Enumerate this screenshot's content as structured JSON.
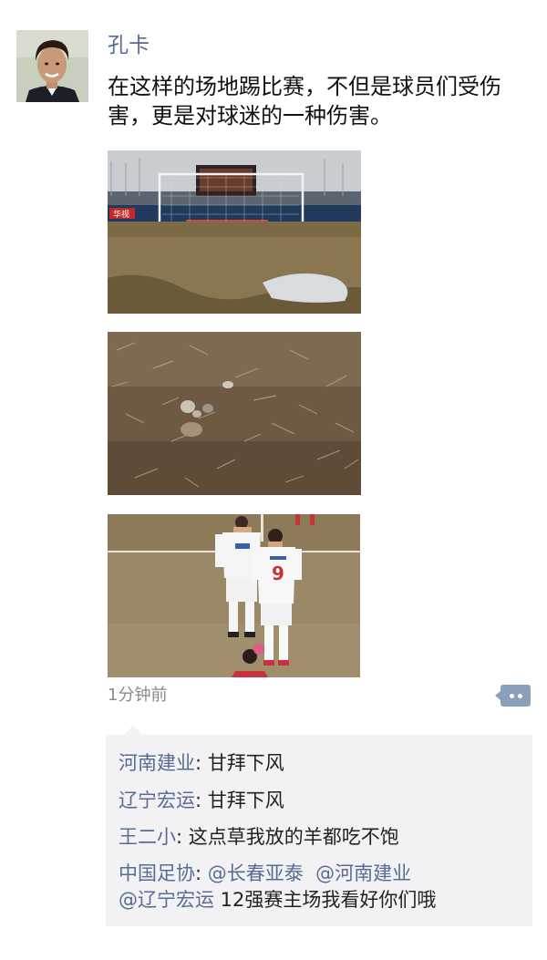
{
  "post": {
    "username": "孔卡",
    "text": "在这样的场地踢比赛，不但是球员们受伤害，更是对球迷的一种伤害。",
    "time": "1分钟前",
    "photos": [
      {
        "icon": "stadium-pitch-photo",
        "banner_text": "华视"
      },
      {
        "icon": "dirt-closeup-photo"
      },
      {
        "icon": "players-on-pitch-photo",
        "shirt_number": "9"
      }
    ]
  },
  "comments": [
    {
      "name": "河南建业",
      "separator": ": ",
      "text": "甘拜下风"
    },
    {
      "name": "辽宁宏运",
      "separator": ": ",
      "text": "甘拜下风"
    },
    {
      "name": "王二小",
      "separator": ": ",
      "text": "这点草我放的羊都吃不饱"
    },
    {
      "name": "中国足协",
      "separator": ": ",
      "mention1": "@长春亚泰",
      "mention2": "@河南建业",
      "mention3": "@辽宁宏运",
      "text": " 12强赛主场我看好你们哦"
    }
  ],
  "colors": {
    "link": "#576b95",
    "comment_bg": "#f2f2f4",
    "time": "#8a8a8a"
  }
}
